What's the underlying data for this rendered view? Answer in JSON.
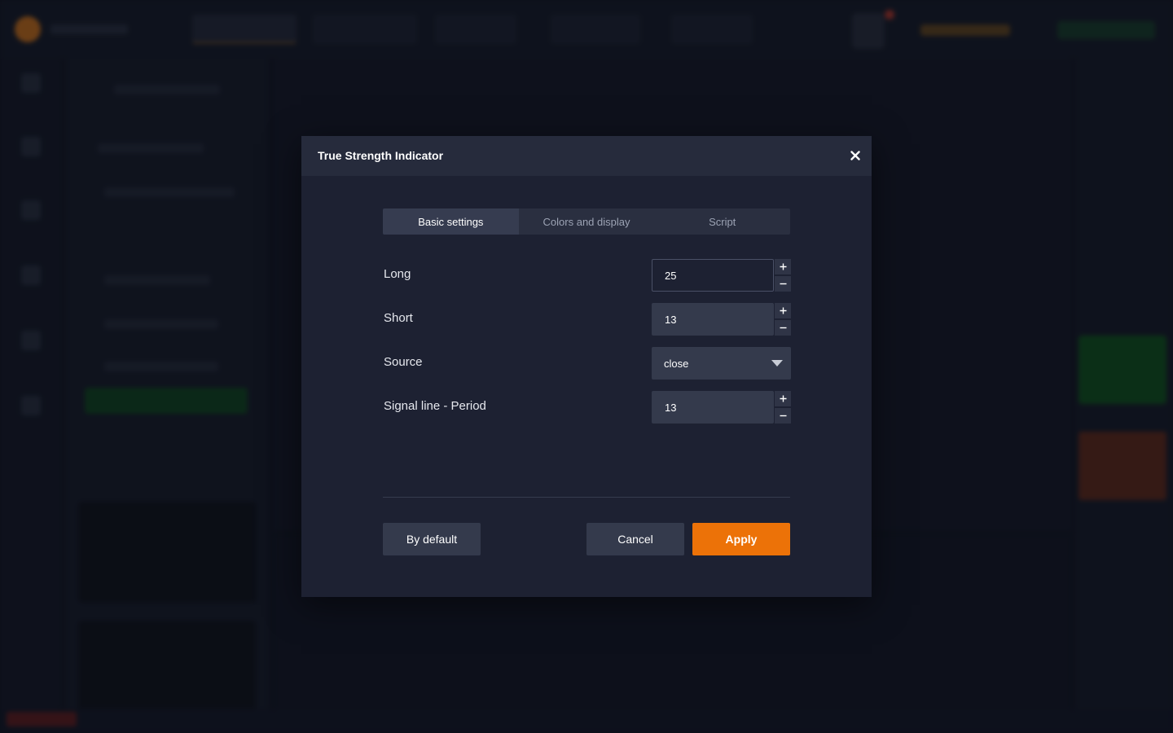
{
  "dialog": {
    "title": "True Strength Indicator",
    "close_icon": "close-icon"
  },
  "tabs": [
    {
      "label": "Basic settings",
      "active": true
    },
    {
      "label": "Colors and display",
      "active": false
    },
    {
      "label": "Script",
      "active": false
    }
  ],
  "fields": {
    "long": {
      "label": "Long",
      "value": "25"
    },
    "short": {
      "label": "Short",
      "value": "13"
    },
    "source": {
      "label": "Source",
      "value": "close"
    },
    "signal_period": {
      "label": "Signal line - Period",
      "value": "13"
    }
  },
  "stepper": {
    "plus": "+",
    "minus": "−"
  },
  "buttons": {
    "default": "By default",
    "cancel": "Cancel",
    "apply": "Apply"
  },
  "colors": {
    "accent": "#ec7208",
    "dialog_bg": "#1d2132",
    "header_bg": "#262b3c",
    "input_bg": "#343a4c"
  }
}
